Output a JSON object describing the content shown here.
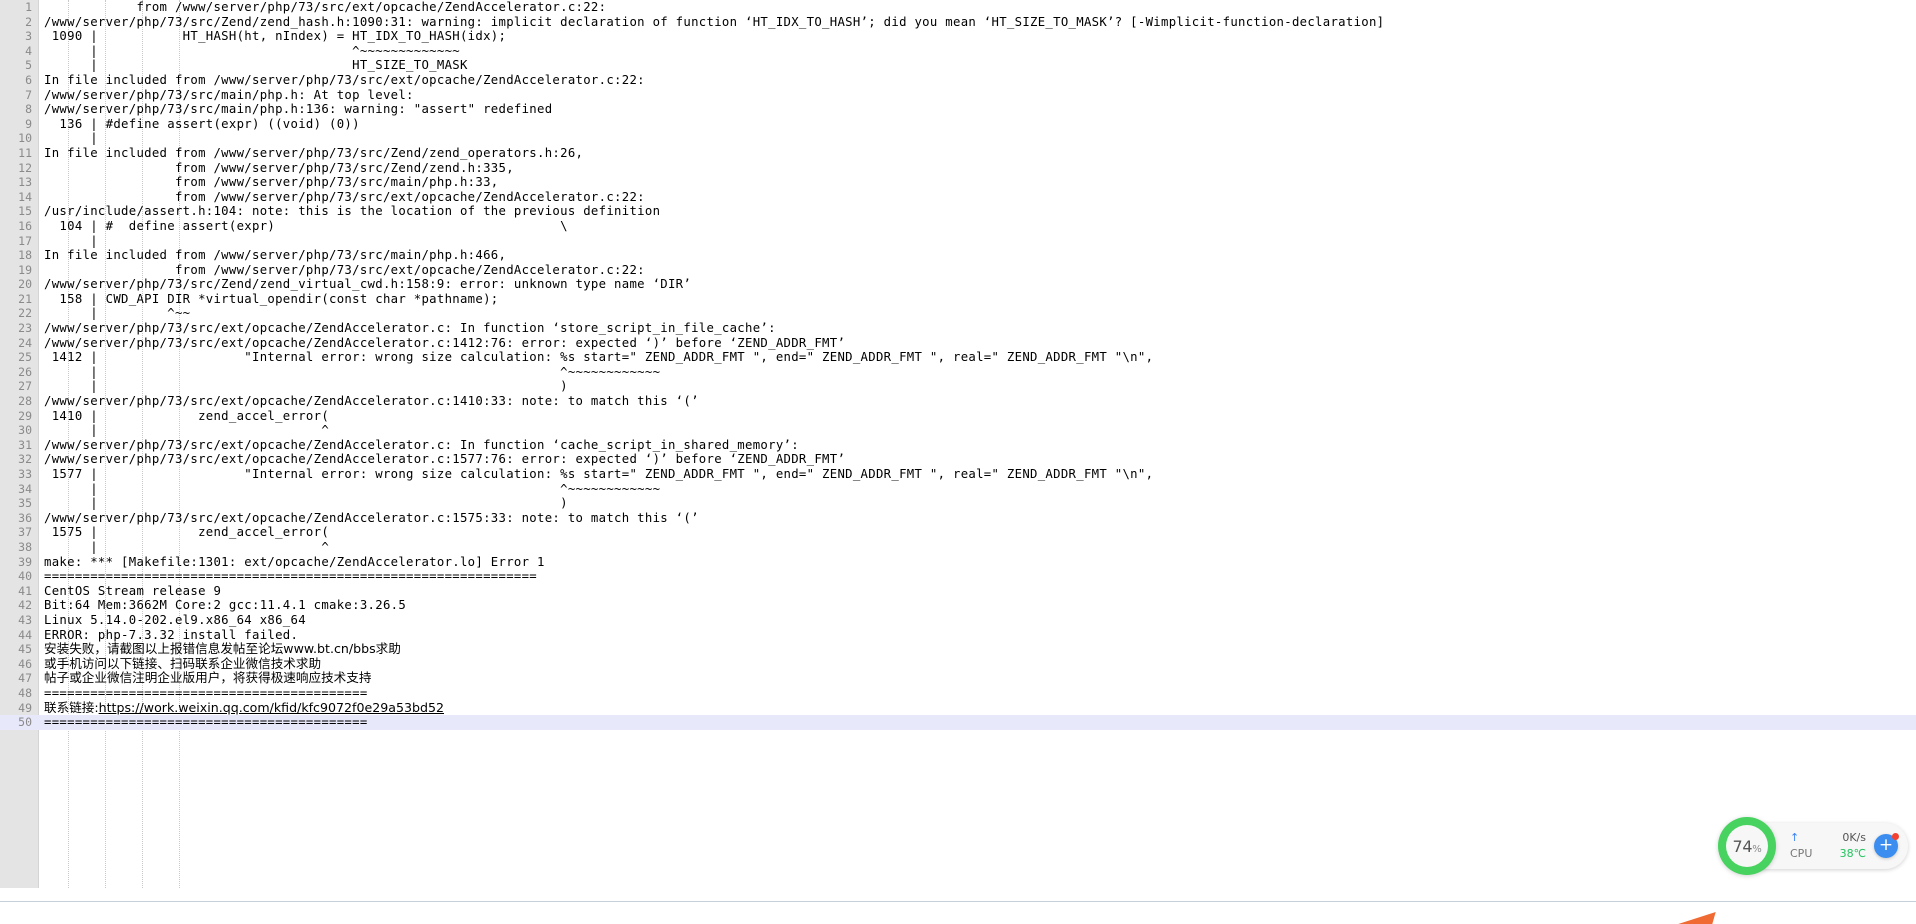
{
  "viewer": {
    "name": "build-log-output",
    "current_line": 50,
    "lines": [
      {
        "n": 1,
        "text": "            from /www/server/php/73/src/ext/opcache/ZendAccelerator.c:22:"
      },
      {
        "n": 2,
        "text": "/www/server/php/73/src/Zend/zend_hash.h:1090:31: warning: implicit declaration of function ‘HT_IDX_TO_HASH’; did you mean ‘HT_SIZE_TO_MASK’? [-Wimplicit-function-declaration]"
      },
      {
        "n": 3,
        "text": " 1090 |           HT_HASH(ht, nIndex) = HT_IDX_TO_HASH(idx);"
      },
      {
        "n": 4,
        "text": "      |                                 ^~~~~~~~~~~~~~"
      },
      {
        "n": 5,
        "text": "      |                                 HT_SIZE_TO_MASK"
      },
      {
        "n": 6,
        "text": "In file included from /www/server/php/73/src/ext/opcache/ZendAccelerator.c:22:"
      },
      {
        "n": 7,
        "text": "/www/server/php/73/src/main/php.h: At top level:"
      },
      {
        "n": 8,
        "text": "/www/server/php/73/src/main/php.h:136: warning: \"assert\" redefined"
      },
      {
        "n": 9,
        "text": "  136 | #define assert(expr) ((void) (0))"
      },
      {
        "n": 10,
        "text": "      |"
      },
      {
        "n": 11,
        "text": "In file included from /www/server/php/73/src/Zend/zend_operators.h:26,"
      },
      {
        "n": 12,
        "text": "                 from /www/server/php/73/src/Zend/zend.h:335,"
      },
      {
        "n": 13,
        "text": "                 from /www/server/php/73/src/main/php.h:33,"
      },
      {
        "n": 14,
        "text": "                 from /www/server/php/73/src/ext/opcache/ZendAccelerator.c:22:"
      },
      {
        "n": 15,
        "text": "/usr/include/assert.h:104: note: this is the location of the previous definition"
      },
      {
        "n": 16,
        "text": "  104 | #  define assert(expr)                                     \\"
      },
      {
        "n": 17,
        "text": "      |"
      },
      {
        "n": 18,
        "text": "In file included from /www/server/php/73/src/main/php.h:466,"
      },
      {
        "n": 19,
        "text": "                 from /www/server/php/73/src/ext/opcache/ZendAccelerator.c:22:"
      },
      {
        "n": 20,
        "text": "/www/server/php/73/src/Zend/zend_virtual_cwd.h:158:9: error: unknown type name ‘DIR’"
      },
      {
        "n": 21,
        "text": "  158 | CWD_API DIR *virtual_opendir(const char *pathname);"
      },
      {
        "n": 22,
        "text": "      |         ^~~"
      },
      {
        "n": 23,
        "text": "/www/server/php/73/src/ext/opcache/ZendAccelerator.c: In function ‘store_script_in_file_cache’:"
      },
      {
        "n": 24,
        "text": "/www/server/php/73/src/ext/opcache/ZendAccelerator.c:1412:76: error: expected ‘)’ before ‘ZEND_ADDR_FMT’"
      },
      {
        "n": 25,
        "text": " 1412 |                   \"Internal error: wrong size calculation: %s start=\" ZEND_ADDR_FMT \", end=\" ZEND_ADDR_FMT \", real=\" ZEND_ADDR_FMT \"\\n\","
      },
      {
        "n": 26,
        "text": "      |                                                            ^~~~~~~~~~~~~"
      },
      {
        "n": 27,
        "text": "      |                                                            )"
      },
      {
        "n": 28,
        "text": "/www/server/php/73/src/ext/opcache/ZendAccelerator.c:1410:33: note: to match this ‘(’"
      },
      {
        "n": 29,
        "text": " 1410 |             zend_accel_error("
      },
      {
        "n": 30,
        "text": "      |                             ^"
      },
      {
        "n": 31,
        "text": "/www/server/php/73/src/ext/opcache/ZendAccelerator.c: In function ‘cache_script_in_shared_memory’:"
      },
      {
        "n": 32,
        "text": "/www/server/php/73/src/ext/opcache/ZendAccelerator.c:1577:76: error: expected ‘)’ before ‘ZEND_ADDR_FMT’"
      },
      {
        "n": 33,
        "text": " 1577 |                   \"Internal error: wrong size calculation: %s start=\" ZEND_ADDR_FMT \", end=\" ZEND_ADDR_FMT \", real=\" ZEND_ADDR_FMT \"\\n\","
      },
      {
        "n": 34,
        "text": "      |                                                            ^~~~~~~~~~~~~"
      },
      {
        "n": 35,
        "text": "      |                                                            )"
      },
      {
        "n": 36,
        "text": "/www/server/php/73/src/ext/opcache/ZendAccelerator.c:1575:33: note: to match this ‘(’"
      },
      {
        "n": 37,
        "text": " 1575 |             zend_accel_error("
      },
      {
        "n": 38,
        "text": "      |                             ^"
      },
      {
        "n": 39,
        "text": "make: *** [Makefile:1301: ext/opcache/ZendAccelerator.lo] Error 1"
      },
      {
        "n": 40,
        "text": "================================================================"
      },
      {
        "n": 41,
        "text": "CentOS Stream release 9"
      },
      {
        "n": 42,
        "text": "Bit:64 Mem:3662M Core:2 gcc:11.4.1 cmake:3.26.5"
      },
      {
        "n": 43,
        "text": "Linux 5.14.0-202.el9.x86_64 x86_64"
      },
      {
        "n": 44,
        "text": "ERROR: php-7.3.32 install failed."
      },
      {
        "n": 45,
        "text": "安装失败，请截图以上报错信息发帖至论坛www.bt.cn/bbs求助",
        "cjk": true
      },
      {
        "n": 46,
        "text": "或手机访问以下链接、扫码联系企业微信技术求助",
        "cjk": true
      },
      {
        "n": 47,
        "text": "帖子或企业微信注明企业版用户，将获得极速响应技术支持",
        "cjk": true
      },
      {
        "n": 48,
        "text": "=========================================="
      },
      {
        "n": 49,
        "text": "联系链接:https://work.weixin.qq.com/kfid/kfc9072f0e29a53bd52",
        "cjk": true,
        "link": "https://work.weixin.qq.com/kfid/kfc9072f0e29a53bd52",
        "prefix": "联系链接:"
      },
      {
        "n": 50,
        "text": "=========================================="
      }
    ]
  },
  "perf_widget": {
    "name": "system-monitor-widget",
    "cpu_ring_value": "74",
    "cpu_ring_unit": "%",
    "net_arrow": "↑",
    "net_speed": "0K/s",
    "cpu_label": "CPU",
    "cpu_temp": "38℃",
    "add_label": "+",
    "ring_color": "#48d25f",
    "accent_color": "#3b8ef0",
    "badge_color": "#f3402f"
  },
  "colors": {
    "gutter_bg": "#e4e4e4",
    "gutter_text": "#8a8a8a",
    "text": "#000000",
    "current_line_bg": "#e8e8fb",
    "page_bg": "#ffffff"
  }
}
